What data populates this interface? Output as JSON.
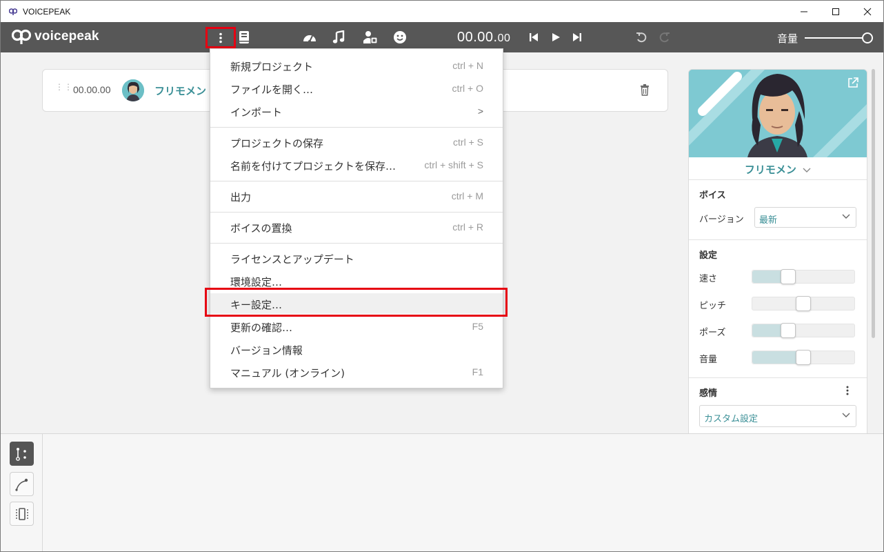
{
  "window": {
    "title": "VOICEPEAK"
  },
  "toolbar": {
    "logo_text": "voicepeak",
    "time_main": "00.00.",
    "time_ms": "00",
    "volume_label": "音量",
    "volume_level": 1.0
  },
  "block": {
    "time": "00.00.00",
    "voice_name": "フリモメン"
  },
  "menu": {
    "items": [
      {
        "label": "新規プロジェクト",
        "shortcut": "ctrl + N"
      },
      {
        "label": "ファイルを開く…",
        "shortcut": "ctrl + O"
      },
      {
        "label": "インポート",
        "shortcut": ">"
      },
      {
        "label": "プロジェクトの保存",
        "shortcut": "ctrl + S"
      },
      {
        "label": "名前を付けてプロジェクトを保存…",
        "shortcut": "ctrl + shift + S"
      },
      {
        "label": "出力",
        "shortcut": "ctrl + M"
      },
      {
        "label": "ボイスの置換",
        "shortcut": "ctrl + R"
      },
      {
        "label": "ライセンスとアップデート",
        "shortcut": ""
      },
      {
        "label": "環境設定…",
        "shortcut": ""
      },
      {
        "label": "キー設定…",
        "shortcut": ""
      },
      {
        "label": "更新の確認…",
        "shortcut": "F5"
      },
      {
        "label": "バージョン情報",
        "shortcut": ""
      },
      {
        "label": "マニュアル (オンライン)",
        "shortcut": "F1"
      }
    ]
  },
  "panel": {
    "voice_name": "フリモメン",
    "voice_section": "ボイス",
    "version_label": "バージョン",
    "version_value": "最新",
    "settings_section": "設定",
    "sliders": [
      {
        "label": "速さ",
        "value": 0.35
      },
      {
        "label": "ピッチ",
        "value": 0.5
      },
      {
        "label": "ポーズ",
        "value": 0.35
      },
      {
        "label": "音量",
        "value": 0.5
      }
    ],
    "emotion_section": "感情",
    "emotion_value": "カスタム設定"
  },
  "colors": {
    "toolbar_bg": "#575757",
    "accent": "#3a8f96",
    "highlight": "#e60012"
  }
}
